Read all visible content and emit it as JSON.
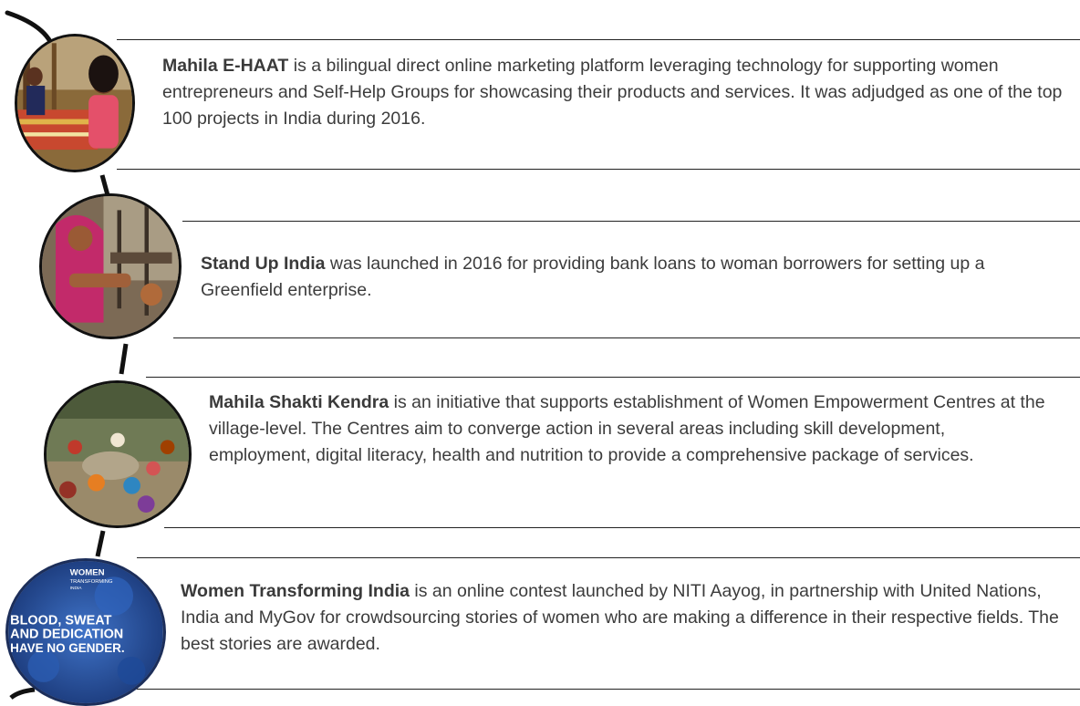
{
  "entries": [
    {
      "title": "Mahila E-HAAT",
      "body": " is a bilingual direct online marketing platform leveraging technology for supporting women entrepreneurs and Self-Help Groups for showcasing their products and services. It was adjudged as one of the top 100 projects in India during 2016.",
      "image_icon": "weaving-women-photo"
    },
    {
      "title": "Stand Up India",
      "body": " was launched in 2016 for providing bank loans to woman borrowers for setting up a Greenfield enterprise.",
      "image_icon": "woman-at-loom-photo"
    },
    {
      "title": "Mahila Shakti Kendra",
      "body": " is an initiative that supports establishment of Women Empowerment Centres at the village-level. The Centres aim to converge action in several areas including skill development, employment, digital literacy, health and nutrition to provide a comprehensive package of services.",
      "image_icon": "village-gathering-photo"
    },
    {
      "title": "Women Transforming India",
      "body": " is an online contest launched by NITI Aayog, in partnership with United Nations, India and MyGov for crowdsourcing stories of women who are making a difference in their respective fields. The best stories are awarded.",
      "image_icon": "contest-poster-image",
      "poster_text": {
        "top_1": "WOMEN",
        "top_2": "TRANSFORMING",
        "top_3": "INDIA",
        "line_1": "BLOOD, SWEAT",
        "line_2": "AND DEDICATION",
        "line_3": "HAVE NO GENDER."
      }
    }
  ],
  "colors": {
    "text": "#3c3c3c",
    "rule": "#222222",
    "poster_blue": "#1f4fa8"
  }
}
